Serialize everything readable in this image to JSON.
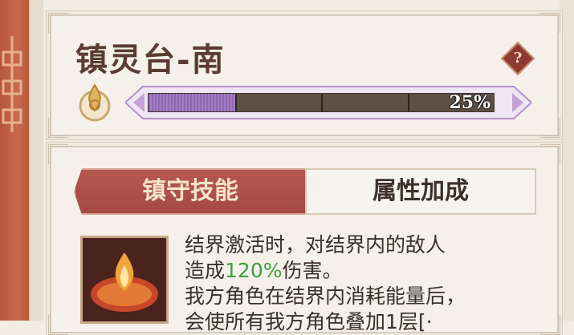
{
  "header": {
    "title": "镇灵台-南",
    "help_icon": "?",
    "progress": {
      "value": 0.25,
      "label": "25%",
      "segments": 4
    }
  },
  "tabs": [
    {
      "label": "镇守技能",
      "active": true
    },
    {
      "label": "属性加成",
      "active": false
    }
  ],
  "skill": {
    "icon": "fire-icon",
    "line1": "结界激活时，对结界内的敌人",
    "line2_prefix": "造成",
    "line2_highlight": "120%",
    "line2_suffix": "伤害。",
    "line3": "我方角色在结界内消耗能量后，",
    "line4": "会使所有我方角色叠加1层[·"
  },
  "colors": {
    "highlight": "#39a33a",
    "tab_active": "#a44a43",
    "progress_fill": "#9a74bb"
  }
}
